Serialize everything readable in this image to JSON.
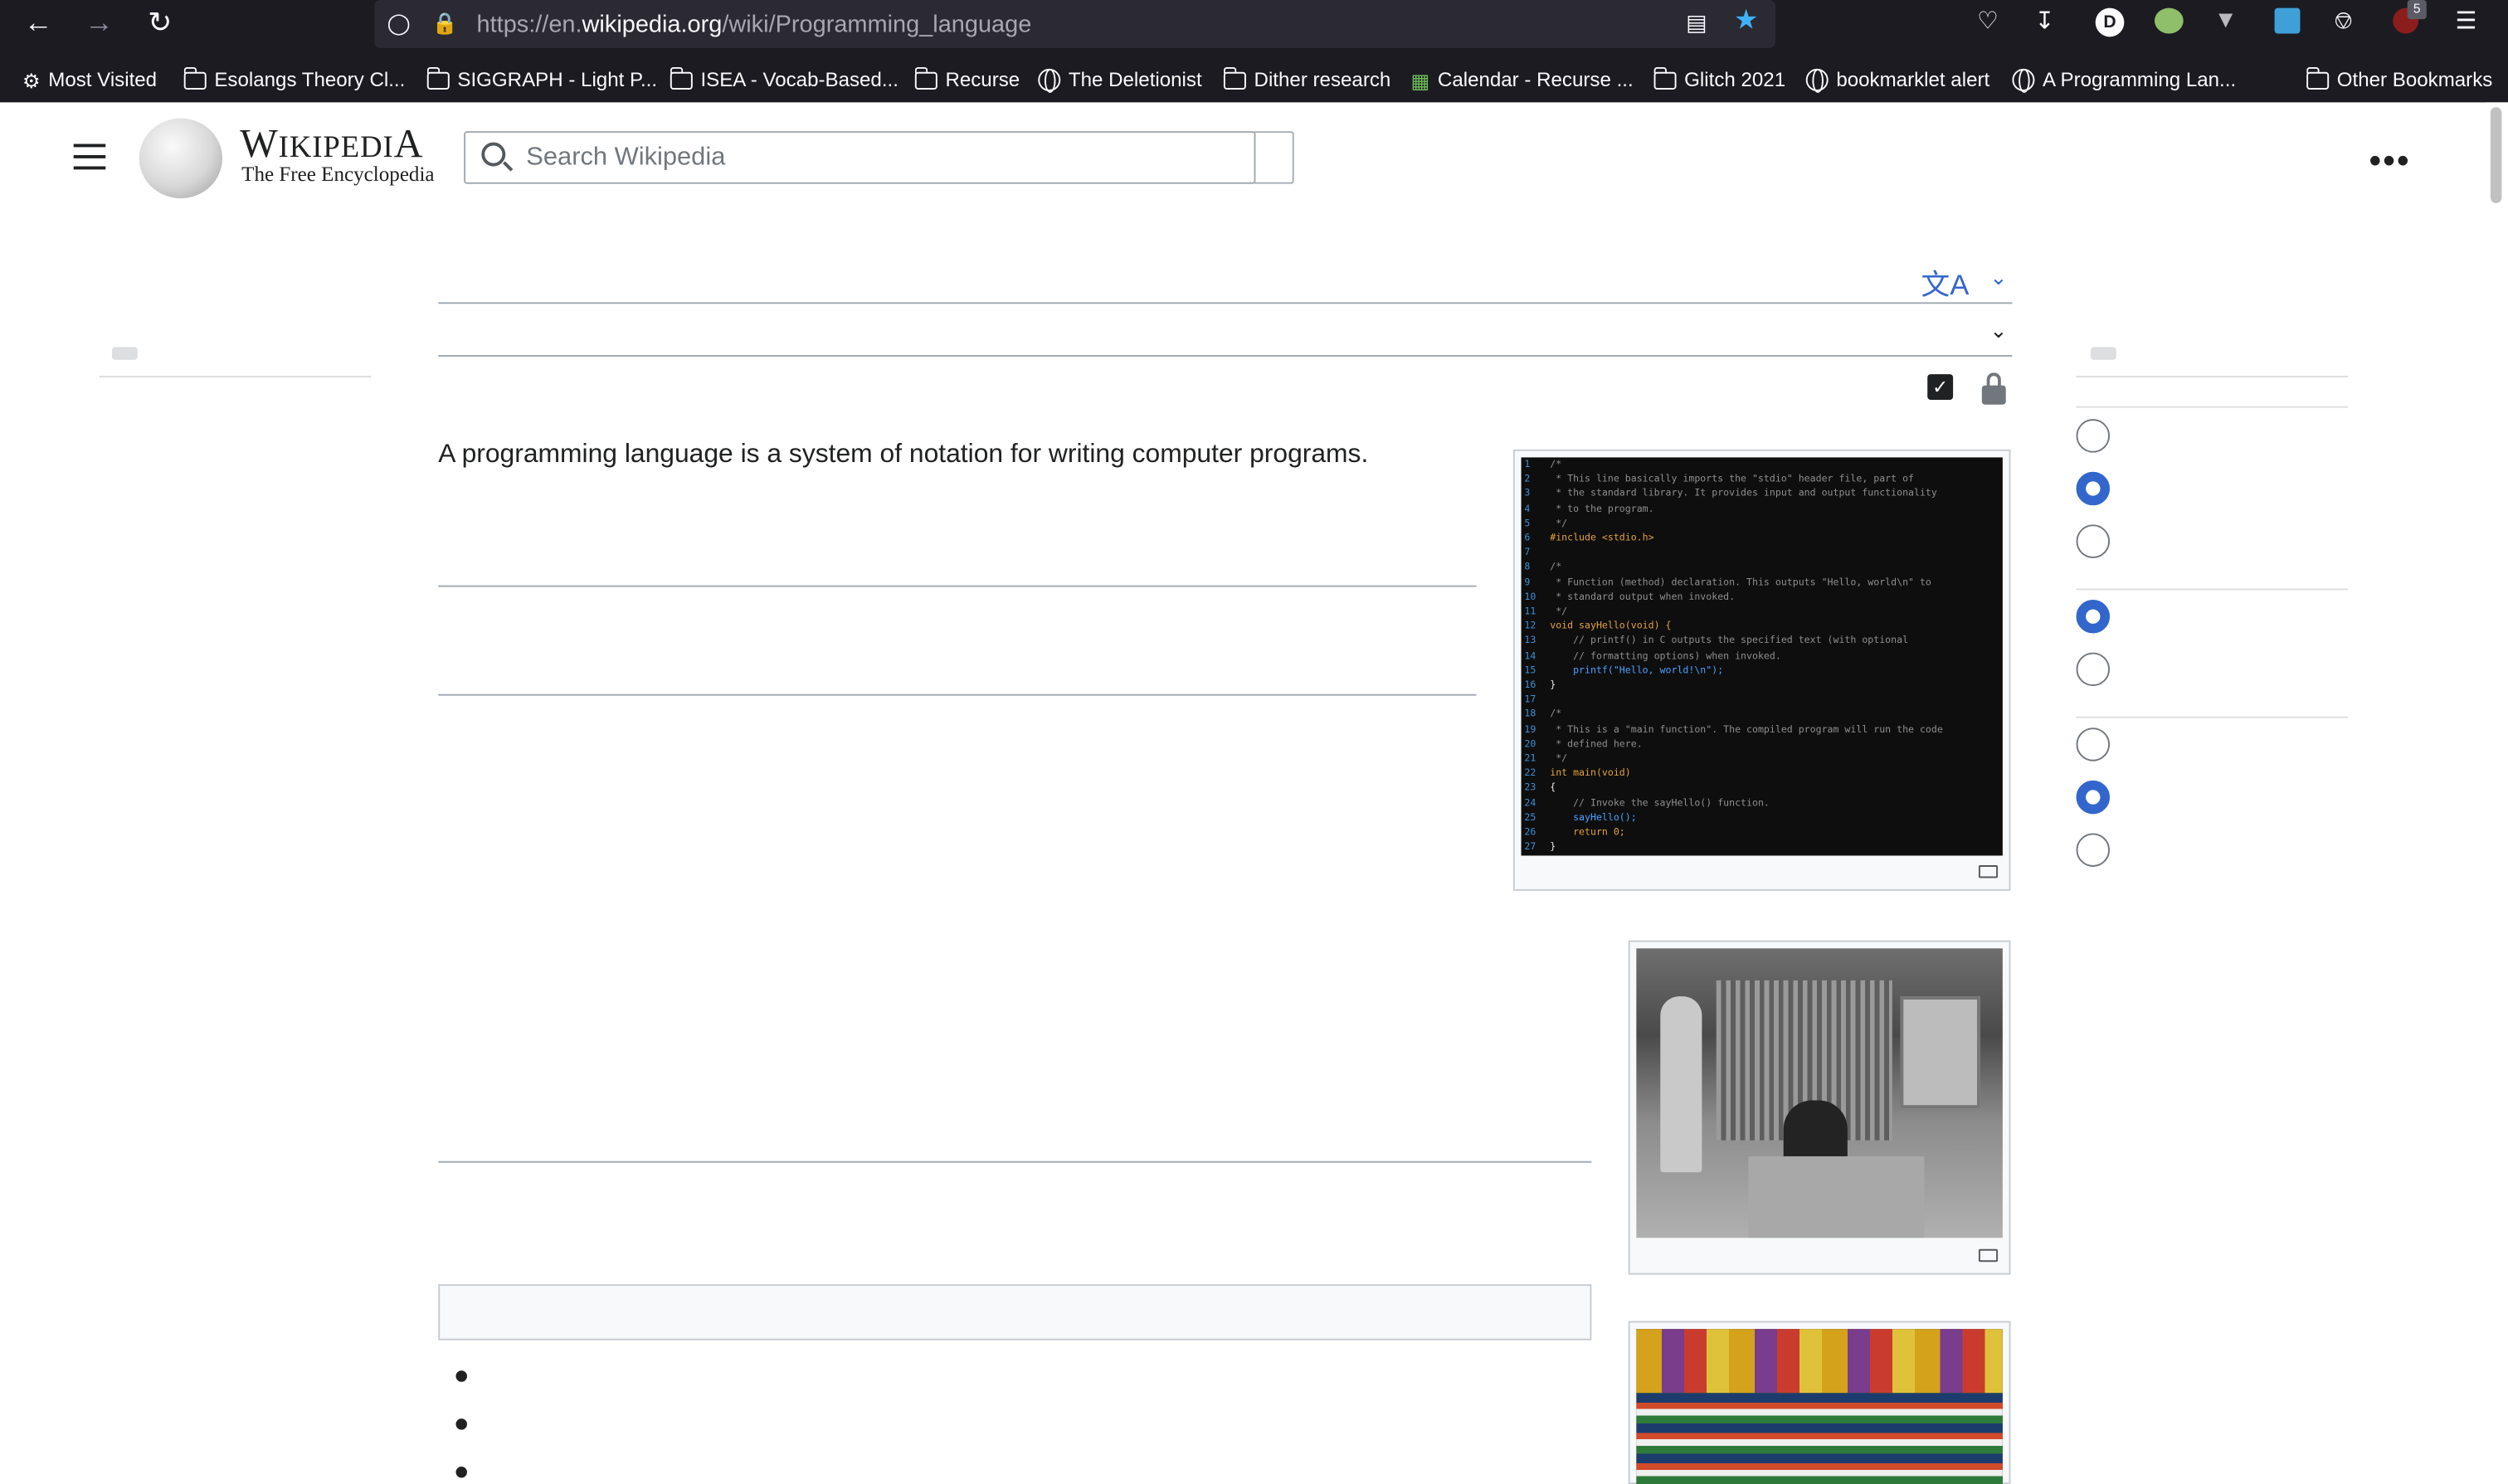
{
  "browser": {
    "url_prefix": "https://en.",
    "url_domain": "wikipedia.org",
    "url_path": "/wiki/Programming_language",
    "avatar_letter": "D",
    "badge_count": "5"
  },
  "bookmarks": [
    {
      "label": "Most Visited",
      "icon": "gear-icon"
    },
    {
      "label": "Esolangs Theory Cl...",
      "icon": "folder-icon"
    },
    {
      "label": "SIGGRAPH - Light P...",
      "icon": "folder-icon"
    },
    {
      "label": "ISEA - Vocab-Based...",
      "icon": "folder-icon"
    },
    {
      "label": "Recurse",
      "icon": "folder-icon"
    },
    {
      "label": "The Deletionist",
      "icon": "globe-icon"
    },
    {
      "label": "Dither research",
      "icon": "folder-icon"
    },
    {
      "label": "Calendar - Recurse ...",
      "icon": "calendar-icon"
    },
    {
      "label": "Glitch 2021",
      "icon": "folder-icon"
    },
    {
      "label": "bookmarklet alert",
      "icon": "globe-icon"
    },
    {
      "label": "A Programming Lan...",
      "icon": "globe-icon"
    }
  ],
  "other_bookmarks": "Other Bookmarks",
  "wiki": {
    "wordmark": "WIKIPEDIA",
    "wordmark_display": "Wikipedia",
    "tagline": "The Free Encyclopedia",
    "search_placeholder": "Search Wikipedia"
  },
  "article": {
    "lead": "A programming language is a system of notation for writing computer programs."
  },
  "code_lines": [
    [
      "1",
      "cm",
      "/*"
    ],
    [
      "2",
      "cm",
      " * This line basically imports the \"stdio\" header file, part of"
    ],
    [
      "3",
      "cm",
      " * the standard library. It provides input and output functionality"
    ],
    [
      "4",
      "cm",
      " * to the program."
    ],
    [
      "5",
      "cm",
      " */"
    ],
    [
      "6",
      "kw",
      "#include <stdio.h>"
    ],
    [
      "7",
      "cm",
      ""
    ],
    [
      "8",
      "cm",
      "/*"
    ],
    [
      "9",
      "cm",
      " * Function (method) declaration. This outputs \"Hello, world\\n\" to"
    ],
    [
      "10",
      "cm",
      " * standard output when invoked."
    ],
    [
      "11",
      "cm",
      " */"
    ],
    [
      "12",
      "kw",
      "void sayHello(void) {"
    ],
    [
      "13",
      "cm",
      "    // printf() in C outputs the specified text (with optional"
    ],
    [
      "14",
      "cm",
      "    // formatting options) when invoked."
    ],
    [
      "15",
      "fn",
      "    printf(\"Hello, world!\\n\");"
    ],
    [
      "16",
      "tx",
      "}"
    ],
    [
      "17",
      "cm",
      ""
    ],
    [
      "18",
      "cm",
      "/*"
    ],
    [
      "19",
      "cm",
      " * This is a \"main function\". The compiled program will run the code"
    ],
    [
      "20",
      "cm",
      " * defined here."
    ],
    [
      "21",
      "cm",
      " */"
    ],
    [
      "22",
      "kw",
      "int main(void)"
    ],
    [
      "23",
      "tx",
      "{"
    ],
    [
      "24",
      "cm",
      "    // Invoke the sayHello() function."
    ],
    [
      "25",
      "fn",
      "    sayHello();"
    ],
    [
      "26",
      "kw",
      "    return 0;"
    ],
    [
      "27",
      "tx",
      "}"
    ]
  ],
  "colors": {
    "accent": "#3366cc",
    "toolbar": "#1c1b22",
    "urlbar": "#2b2a33",
    "text": "#202122",
    "bookmark_star": "#3fb2ff"
  }
}
